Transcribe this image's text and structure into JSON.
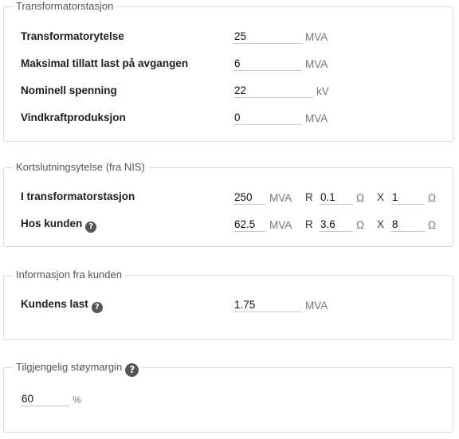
{
  "transformer": {
    "legend": "Transformatorstasjon",
    "rows": [
      {
        "label": "Transformatorytelse",
        "value": "25",
        "unit": "MVA"
      },
      {
        "label": "Maksimal tillatt last på avgangen",
        "value": "6",
        "unit": "MVA"
      },
      {
        "label": "Nominell spenning",
        "value": "22",
        "unit": "kV"
      },
      {
        "label": "Vindkraftproduksjon",
        "value": "0",
        "unit": "MVA"
      }
    ]
  },
  "short_circuit": {
    "legend": "Kortslutningsytelse (fra NIS)",
    "rows": [
      {
        "label": "I transformatorstasjon",
        "value": "250",
        "unit": "MVA",
        "r_label": "R",
        "r_value": "0.1",
        "r_unit": "Ω",
        "x_label": "X",
        "x_value": "1",
        "x_unit": "Ω"
      },
      {
        "label": "Hos kunden",
        "value": "62.5",
        "unit": "MVA",
        "r_label": "R",
        "r_value": "3.6",
        "r_unit": "Ω",
        "x_label": "X",
        "x_value": "8",
        "x_unit": "Ω",
        "help": "?"
      }
    ]
  },
  "customer": {
    "legend": "Informasjon fra kunden",
    "rows": [
      {
        "label": "Kundens last",
        "value": "1.75",
        "unit": "MVA",
        "help": "?"
      }
    ]
  },
  "noise": {
    "legend": "Tilgjengelig støymargin",
    "help": "?",
    "value": "60",
    "unit": "%"
  }
}
